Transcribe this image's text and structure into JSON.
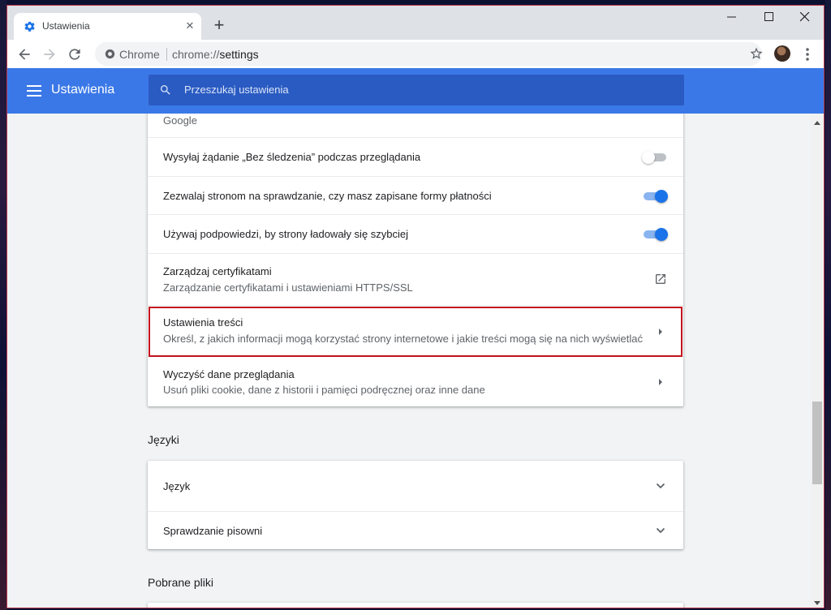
{
  "browser": {
    "tab_title": "Ustawienia",
    "new_tab_symbol": "+",
    "close_symbol": "✕",
    "omnibox_site": "Chrome",
    "omnibox_url_scheme": "chrome://",
    "omnibox_url_host": "settings"
  },
  "header": {
    "title": "Ustawienia",
    "search_placeholder": "Przeszukaj ustawienia"
  },
  "privacy_card": {
    "partial_top": "Google",
    "rows": [
      {
        "label": "Wysyłaj żądanie „Bez śledzenia” podczas przeglądania",
        "toggle": false
      },
      {
        "label": "Zezwalaj stronom na sprawdzanie, czy masz zapisane formy płatności",
        "toggle": true
      },
      {
        "label": "Używaj podpowiedzi, by strony ładowały się szybciej",
        "toggle": true
      },
      {
        "label": "Zarządzaj certyfikatami",
        "sub": "Zarządzanie certyfikatami i ustawieniami HTTPS/SSL",
        "icon": "open-in-new-icon"
      },
      {
        "label": "Ustawienia treści",
        "sub": "Określ, z jakich informacji mogą korzystać strony internetowe i jakie treści mogą się na nich wyświetlać",
        "icon": "arrow-right-icon"
      },
      {
        "label": "Wyczyść dane przeglądania",
        "sub": "Usuń pliki cookie, dane z historii i pamięci podręcznej oraz inne dane",
        "icon": "arrow-right-icon"
      }
    ]
  },
  "languages_section": {
    "title": "Języki",
    "rows": [
      {
        "label": "Język",
        "icon": "expand-more-icon"
      },
      {
        "label": "Sprawdzanie pisowni",
        "icon": "expand-more-icon"
      }
    ]
  },
  "downloads_section": {
    "title": "Pobrane pliki"
  },
  "colors": {
    "header_blue": "#3b78e7",
    "search_blue": "#2a5bc2",
    "toggle_on": "#1a73e8",
    "highlight_red": "#c4121e"
  }
}
